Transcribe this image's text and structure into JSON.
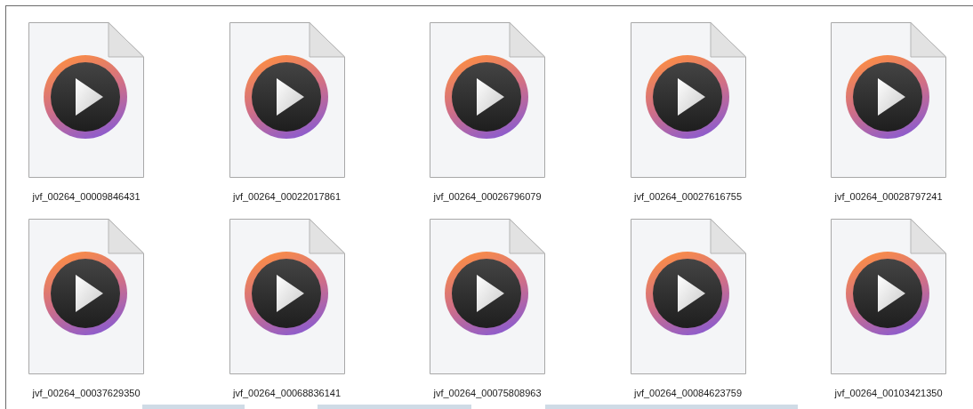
{
  "files": [
    {
      "name": "jvf_00264_00009846431"
    },
    {
      "name": "jvf_00264_00022017861"
    },
    {
      "name": "jvf_00264_00026796079"
    },
    {
      "name": "jvf_00264_00027616755"
    },
    {
      "name": "jvf_00264_00028797241"
    },
    {
      "name": "jvf_00264_00037629350"
    },
    {
      "name": "jvf_00264_00068836141"
    },
    {
      "name": "jvf_00264_00075808963"
    },
    {
      "name": "jvf_00264_00084623759"
    },
    {
      "name": "jvf_00264_00103421350"
    }
  ]
}
